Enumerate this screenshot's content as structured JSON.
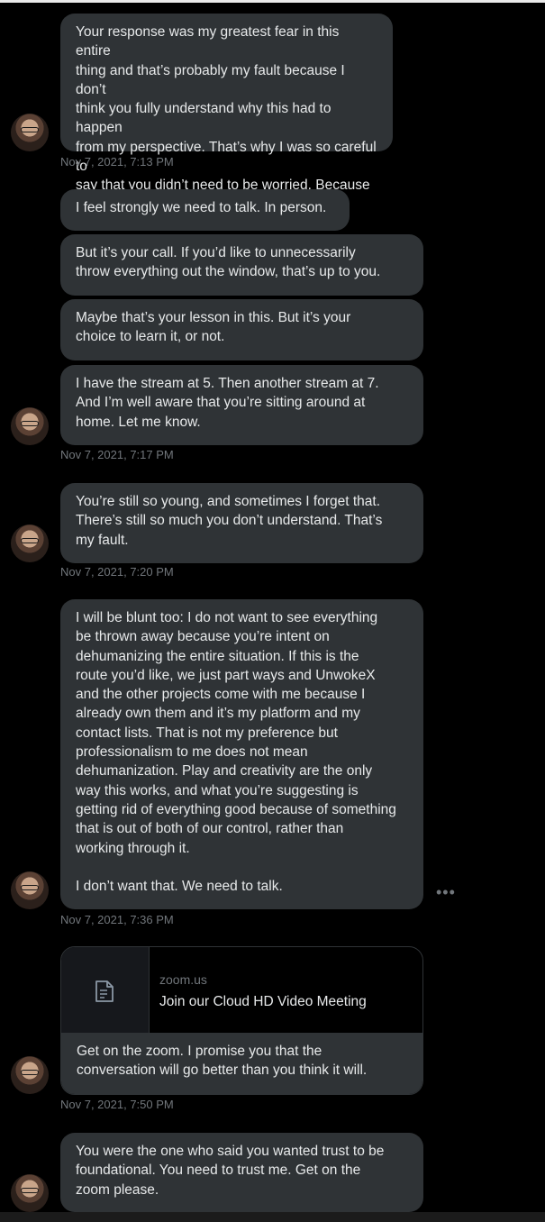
{
  "conversation": {
    "messages": [
      {
        "text": "Your response was my greatest fear in this entire\nthing and that’s probably my fault because I don’t\nthink you fully understand why this had to happen\nfrom my perspective. That’s why I was so careful to\nsay that you didn’t need to be worried. Because you\ndon’t."
      },
      {
        "text": "I feel strongly we need to talk. In person."
      },
      {
        "text": "But it’s your call. If you’d like to unnecessarily\nthrow everything out the window, that’s up to you."
      },
      {
        "text": "Maybe that’s your lesson in this. But it’s your\nchoice to learn it, or not."
      },
      {
        "text": "I have the stream at 5. Then another stream at 7.\nAnd I’m well aware that you’re sitting around at\nhome. Let me know."
      },
      {
        "text": "You’re still so young, and sometimes I forget that.\nThere’s still so much you don’t understand. That’s\nmy fault."
      },
      {
        "text": "I will be blunt too: I do not want to see everything\nbe thrown away because you’re intent on\ndehumanizing the entire situation. If this is the\nroute you’d like, we just part ways and UnwokeX\nand the other projects come with me because I\nalready own them and it’s my platform and my\ncontact lists. That is not my preference but\nprofessionalism to me does not mean\ndehumanization. Play and creativity are the only\nway this works, and what you’re suggesting is\ngetting rid of everything good because of something\nthat is out of both of our control, rather than\nworking through it.\n\nI don’t want that. We need to talk."
      },
      {
        "text": "Get on the zoom. I promise you that the\nconversation will go better than you think it will."
      },
      {
        "text": "You were the one who said you wanted trust to be\nfoundational. You need to trust me. Get on the\nzoom please."
      }
    ],
    "timestamps": [
      "Nov 7, 2021, 7:13 PM",
      "Nov 7, 2021, 7:17 PM",
      "Nov 7, 2021, 7:20 PM",
      "Nov 7, 2021, 7:36 PM",
      "Nov 7, 2021, 7:50 PM"
    ],
    "link_card": {
      "domain": "zoom.us",
      "title": "Join our Cloud HD Video Meeting"
    },
    "more_icon": "ellipsis-icon",
    "more_label": "•••"
  },
  "colors": {
    "background": "#000000",
    "bubble": "#2f3336",
    "text": "#e7e9ea",
    "muted": "#71767b"
  }
}
